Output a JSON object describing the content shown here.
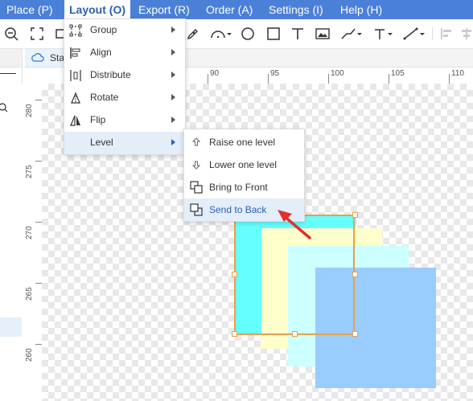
{
  "menubar": {
    "items": [
      "Place (P)",
      "Layout (O)",
      "Export (R)",
      "Order (A)",
      "Settings (I)",
      "Help (H)"
    ],
    "active": "Layout (O)",
    "bg_color": "#4b80d8"
  },
  "toolbar": {
    "icons": [
      "zoom-out-icon",
      "fit-screen-icon",
      "crop-icon",
      "pen-icon",
      "arc-icon",
      "circle-icon",
      "square-icon",
      "text-icon",
      "image-icon",
      "connector-icon",
      "angle-connector-icon",
      "line-connector-icon",
      "align-left-icon",
      "align-center-icon"
    ]
  },
  "document": {
    "tab_label": "Sta"
  },
  "ruler": {
    "top_labels": [
      "90",
      "95",
      "100",
      "105",
      "110"
    ],
    "left_labels": [
      "280",
      "275",
      "270",
      "265",
      "260"
    ]
  },
  "layout_menu": {
    "items": [
      {
        "label": "Group",
        "icon": "group-icon",
        "has_submenu": true
      },
      {
        "label": "Align",
        "icon": "align-icon",
        "has_submenu": true
      },
      {
        "label": "Distribute",
        "icon": "distribute-icon",
        "has_submenu": true
      },
      {
        "label": "Rotate",
        "icon": "rotate-icon",
        "has_submenu": true
      },
      {
        "label": "Flip",
        "icon": "flip-icon",
        "has_submenu": true
      },
      {
        "label": "Level",
        "icon": "",
        "has_submenu": true
      }
    ],
    "highlighted": "Level"
  },
  "level_submenu": {
    "items": [
      {
        "label": "Raise one level",
        "icon": "raise-icon"
      },
      {
        "label": "Lower one level",
        "icon": "lower-icon"
      },
      {
        "label": "Bring to Front",
        "icon": "bring-front-icon"
      },
      {
        "label": "Send to Back",
        "icon": "send-back-icon"
      }
    ],
    "highlighted": "Send to Back"
  },
  "shapes": {
    "colors": [
      "#66ffff",
      "#ffffcc",
      "#ccffff",
      "#99ccff"
    ],
    "selection_color": "#e8a04c"
  },
  "annotation": {
    "color": "#e0302b"
  }
}
